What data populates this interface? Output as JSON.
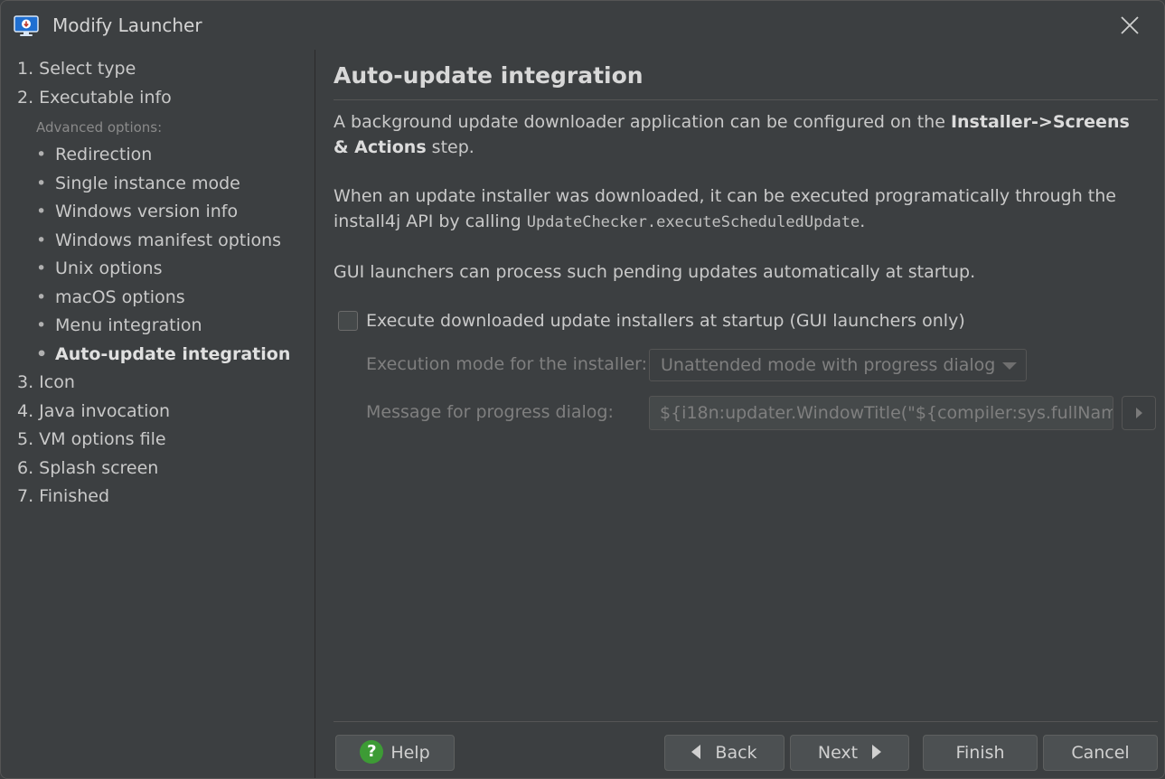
{
  "window": {
    "title": "Modify Launcher",
    "app_icon": "monitor-download-icon",
    "close_icon": "close-icon"
  },
  "sidebar": {
    "steps_before": [
      {
        "label": "1. Select type"
      },
      {
        "label": "2. Executable info"
      }
    ],
    "advanced_label": "Advanced options:",
    "sub_items": [
      {
        "label": "Redirection",
        "active": false
      },
      {
        "label": "Single instance mode",
        "active": false
      },
      {
        "label": "Windows version info",
        "active": false
      },
      {
        "label": "Windows manifest options",
        "active": false
      },
      {
        "label": "Unix options",
        "active": false
      },
      {
        "label": "macOS options",
        "active": false
      },
      {
        "label": "Menu integration",
        "active": false
      },
      {
        "label": "Auto-update integration",
        "active": true
      }
    ],
    "steps_after": [
      {
        "label": "3. Icon"
      },
      {
        "label": "4. Java invocation"
      },
      {
        "label": "5. VM options file"
      },
      {
        "label": "6. Splash screen"
      },
      {
        "label": "7. Finished"
      }
    ]
  },
  "main": {
    "heading": "Auto-update integration",
    "para1": {
      "text_a": "A background update downloader application can be configured on the ",
      "bold": "Installer->Screens & Actions",
      "text_b": " step."
    },
    "para2": {
      "text_a": "When an update installer was downloaded, it can be executed programatically through the install4j API by calling ",
      "code": "UpdateChecker.executeScheduledUpdate",
      "text_b": "."
    },
    "para3": "GUI launchers can process such pending updates automatically at startup.",
    "checkbox": {
      "label": "Execute downloaded update installers at startup (GUI launchers only)",
      "checked": false
    },
    "execution_mode": {
      "label": "Execution mode for the installer:",
      "value": "Unattended mode with progress dialog"
    },
    "progress_message": {
      "label": "Message for progress dialog:",
      "value": "${i18n:updater.WindowTitle(\"${compiler:sys.fullName"
    }
  },
  "footer": {
    "help": "Help",
    "back": "Back",
    "next": "Next",
    "finish": "Finish",
    "cancel": "Cancel"
  },
  "colors": {
    "background": "#3c3f41",
    "help_green": "#3d9b35"
  }
}
